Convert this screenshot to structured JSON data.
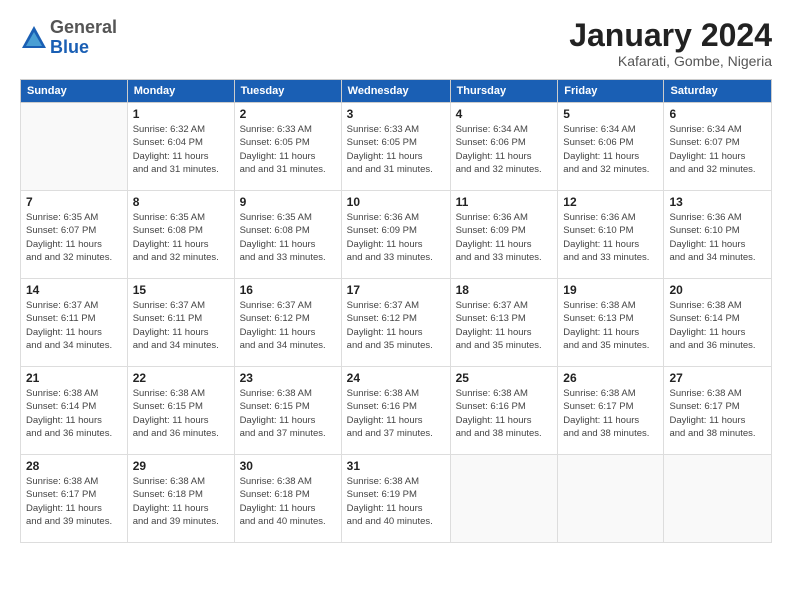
{
  "header": {
    "logo_line1": "General",
    "logo_line2": "Blue",
    "month": "January 2024",
    "location": "Kafarati, Gombe, Nigeria"
  },
  "weekdays": [
    "Sunday",
    "Monday",
    "Tuesday",
    "Wednesday",
    "Thursday",
    "Friday",
    "Saturday"
  ],
  "weeks": [
    [
      {
        "day": "",
        "sunrise": "",
        "sunset": "",
        "daylight": ""
      },
      {
        "day": "1",
        "sunrise": "Sunrise: 6:32 AM",
        "sunset": "Sunset: 6:04 PM",
        "daylight": "Daylight: 11 hours and 31 minutes."
      },
      {
        "day": "2",
        "sunrise": "Sunrise: 6:33 AM",
        "sunset": "Sunset: 6:05 PM",
        "daylight": "Daylight: 11 hours and 31 minutes."
      },
      {
        "day": "3",
        "sunrise": "Sunrise: 6:33 AM",
        "sunset": "Sunset: 6:05 PM",
        "daylight": "Daylight: 11 hours and 31 minutes."
      },
      {
        "day": "4",
        "sunrise": "Sunrise: 6:34 AM",
        "sunset": "Sunset: 6:06 PM",
        "daylight": "Daylight: 11 hours and 32 minutes."
      },
      {
        "day": "5",
        "sunrise": "Sunrise: 6:34 AM",
        "sunset": "Sunset: 6:06 PM",
        "daylight": "Daylight: 11 hours and 32 minutes."
      },
      {
        "day": "6",
        "sunrise": "Sunrise: 6:34 AM",
        "sunset": "Sunset: 6:07 PM",
        "daylight": "Daylight: 11 hours and 32 minutes."
      }
    ],
    [
      {
        "day": "7",
        "sunrise": "Sunrise: 6:35 AM",
        "sunset": "Sunset: 6:07 PM",
        "daylight": "Daylight: 11 hours and 32 minutes."
      },
      {
        "day": "8",
        "sunrise": "Sunrise: 6:35 AM",
        "sunset": "Sunset: 6:08 PM",
        "daylight": "Daylight: 11 hours and 32 minutes."
      },
      {
        "day": "9",
        "sunrise": "Sunrise: 6:35 AM",
        "sunset": "Sunset: 6:08 PM",
        "daylight": "Daylight: 11 hours and 33 minutes."
      },
      {
        "day": "10",
        "sunrise": "Sunrise: 6:36 AM",
        "sunset": "Sunset: 6:09 PM",
        "daylight": "Daylight: 11 hours and 33 minutes."
      },
      {
        "day": "11",
        "sunrise": "Sunrise: 6:36 AM",
        "sunset": "Sunset: 6:09 PM",
        "daylight": "Daylight: 11 hours and 33 minutes."
      },
      {
        "day": "12",
        "sunrise": "Sunrise: 6:36 AM",
        "sunset": "Sunset: 6:10 PM",
        "daylight": "Daylight: 11 hours and 33 minutes."
      },
      {
        "day": "13",
        "sunrise": "Sunrise: 6:36 AM",
        "sunset": "Sunset: 6:10 PM",
        "daylight": "Daylight: 11 hours and 34 minutes."
      }
    ],
    [
      {
        "day": "14",
        "sunrise": "Sunrise: 6:37 AM",
        "sunset": "Sunset: 6:11 PM",
        "daylight": "Daylight: 11 hours and 34 minutes."
      },
      {
        "day": "15",
        "sunrise": "Sunrise: 6:37 AM",
        "sunset": "Sunset: 6:11 PM",
        "daylight": "Daylight: 11 hours and 34 minutes."
      },
      {
        "day": "16",
        "sunrise": "Sunrise: 6:37 AM",
        "sunset": "Sunset: 6:12 PM",
        "daylight": "Daylight: 11 hours and 34 minutes."
      },
      {
        "day": "17",
        "sunrise": "Sunrise: 6:37 AM",
        "sunset": "Sunset: 6:12 PM",
        "daylight": "Daylight: 11 hours and 35 minutes."
      },
      {
        "day": "18",
        "sunrise": "Sunrise: 6:37 AM",
        "sunset": "Sunset: 6:13 PM",
        "daylight": "Daylight: 11 hours and 35 minutes."
      },
      {
        "day": "19",
        "sunrise": "Sunrise: 6:38 AM",
        "sunset": "Sunset: 6:13 PM",
        "daylight": "Daylight: 11 hours and 35 minutes."
      },
      {
        "day": "20",
        "sunrise": "Sunrise: 6:38 AM",
        "sunset": "Sunset: 6:14 PM",
        "daylight": "Daylight: 11 hours and 36 minutes."
      }
    ],
    [
      {
        "day": "21",
        "sunrise": "Sunrise: 6:38 AM",
        "sunset": "Sunset: 6:14 PM",
        "daylight": "Daylight: 11 hours and 36 minutes."
      },
      {
        "day": "22",
        "sunrise": "Sunrise: 6:38 AM",
        "sunset": "Sunset: 6:15 PM",
        "daylight": "Daylight: 11 hours and 36 minutes."
      },
      {
        "day": "23",
        "sunrise": "Sunrise: 6:38 AM",
        "sunset": "Sunset: 6:15 PM",
        "daylight": "Daylight: 11 hours and 37 minutes."
      },
      {
        "day": "24",
        "sunrise": "Sunrise: 6:38 AM",
        "sunset": "Sunset: 6:16 PM",
        "daylight": "Daylight: 11 hours and 37 minutes."
      },
      {
        "day": "25",
        "sunrise": "Sunrise: 6:38 AM",
        "sunset": "Sunset: 6:16 PM",
        "daylight": "Daylight: 11 hours and 38 minutes."
      },
      {
        "day": "26",
        "sunrise": "Sunrise: 6:38 AM",
        "sunset": "Sunset: 6:17 PM",
        "daylight": "Daylight: 11 hours and 38 minutes."
      },
      {
        "day": "27",
        "sunrise": "Sunrise: 6:38 AM",
        "sunset": "Sunset: 6:17 PM",
        "daylight": "Daylight: 11 hours and 38 minutes."
      }
    ],
    [
      {
        "day": "28",
        "sunrise": "Sunrise: 6:38 AM",
        "sunset": "Sunset: 6:17 PM",
        "daylight": "Daylight: 11 hours and 39 minutes."
      },
      {
        "day": "29",
        "sunrise": "Sunrise: 6:38 AM",
        "sunset": "Sunset: 6:18 PM",
        "daylight": "Daylight: 11 hours and 39 minutes."
      },
      {
        "day": "30",
        "sunrise": "Sunrise: 6:38 AM",
        "sunset": "Sunset: 6:18 PM",
        "daylight": "Daylight: 11 hours and 40 minutes."
      },
      {
        "day": "31",
        "sunrise": "Sunrise: 6:38 AM",
        "sunset": "Sunset: 6:19 PM",
        "daylight": "Daylight: 11 hours and 40 minutes."
      },
      {
        "day": "",
        "sunrise": "",
        "sunset": "",
        "daylight": ""
      },
      {
        "day": "",
        "sunrise": "",
        "sunset": "",
        "daylight": ""
      },
      {
        "day": "",
        "sunrise": "",
        "sunset": "",
        "daylight": ""
      }
    ]
  ]
}
